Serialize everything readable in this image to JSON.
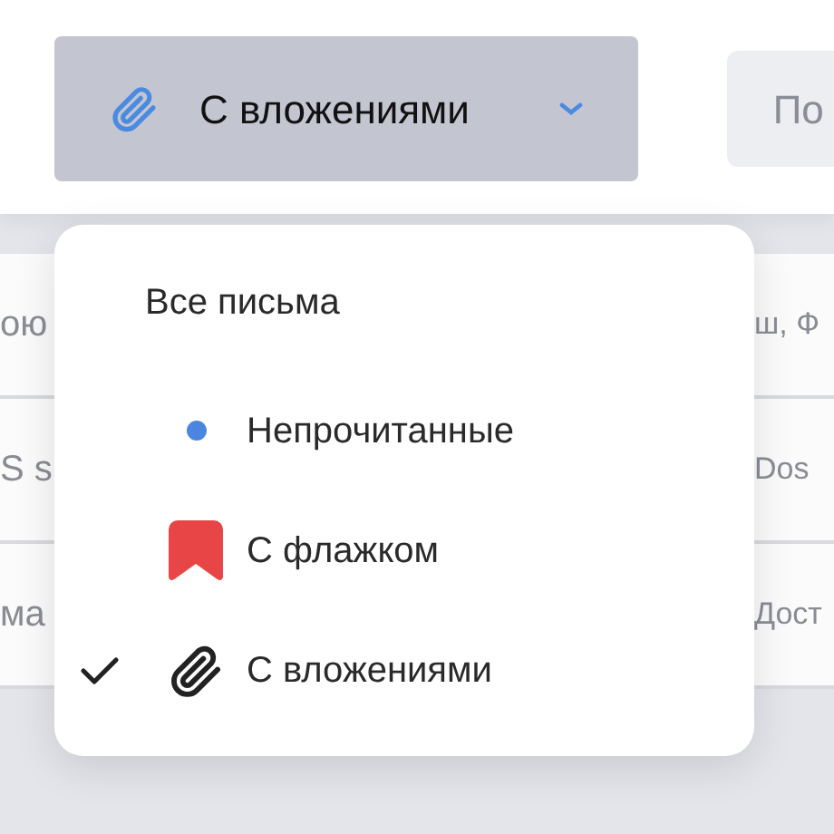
{
  "toolbar": {
    "filter_button": {
      "label": "С вложениями"
    },
    "second_button": {
      "label": "По"
    }
  },
  "rows": [
    {
      "left": "ою",
      "right": "ш, Ф"
    },
    {
      "left": "S s",
      "right": "Dos"
    },
    {
      "left": "ма",
      "right": "Дост"
    }
  ],
  "filter_menu": {
    "items": [
      {
        "kind": "all",
        "label": "Все письма",
        "selected": false
      },
      {
        "kind": "unread",
        "label": "Непрочитанные",
        "selected": false
      },
      {
        "kind": "flagged",
        "label": "С флажком",
        "selected": false
      },
      {
        "kind": "attachments",
        "label": "С вложениями",
        "selected": true
      }
    ]
  }
}
